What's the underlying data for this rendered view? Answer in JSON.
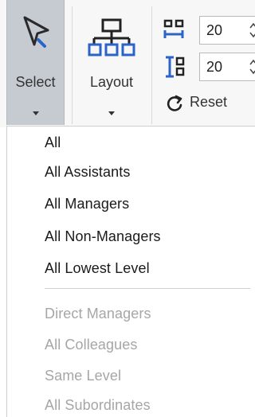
{
  "ribbon": {
    "select_label": "Select",
    "layout_label": "Layout",
    "spacing_horizontal_value": "20",
    "spacing_vertical_value": "20",
    "reset_label": "Reset"
  },
  "menu": {
    "items": [
      {
        "label": "All",
        "enabled": true
      },
      {
        "label": "All Assistants",
        "enabled": true
      },
      {
        "label": "All Managers",
        "enabled": true
      },
      {
        "label": "All Non-Managers",
        "enabled": true
      },
      {
        "label": "All Lowest Level",
        "enabled": true
      },
      {
        "label": "Direct Managers",
        "enabled": false
      },
      {
        "label": "All Colleagues",
        "enabled": false
      },
      {
        "label": "Same Level",
        "enabled": false
      },
      {
        "label": "All Subordinates",
        "enabled": false
      }
    ]
  },
  "colors": {
    "active_button_bg": "#c6cbd2",
    "icon_blue": "#2b63c9",
    "disabled_text": "#a6a6a6"
  },
  "icons": {
    "select": "cursor-arrow-icon",
    "layout": "org-chart-icon",
    "horizontal_spacing": "horizontal-spacing-icon",
    "vertical_spacing": "vertical-spacing-icon",
    "reset": "reset-refresh-icon"
  }
}
